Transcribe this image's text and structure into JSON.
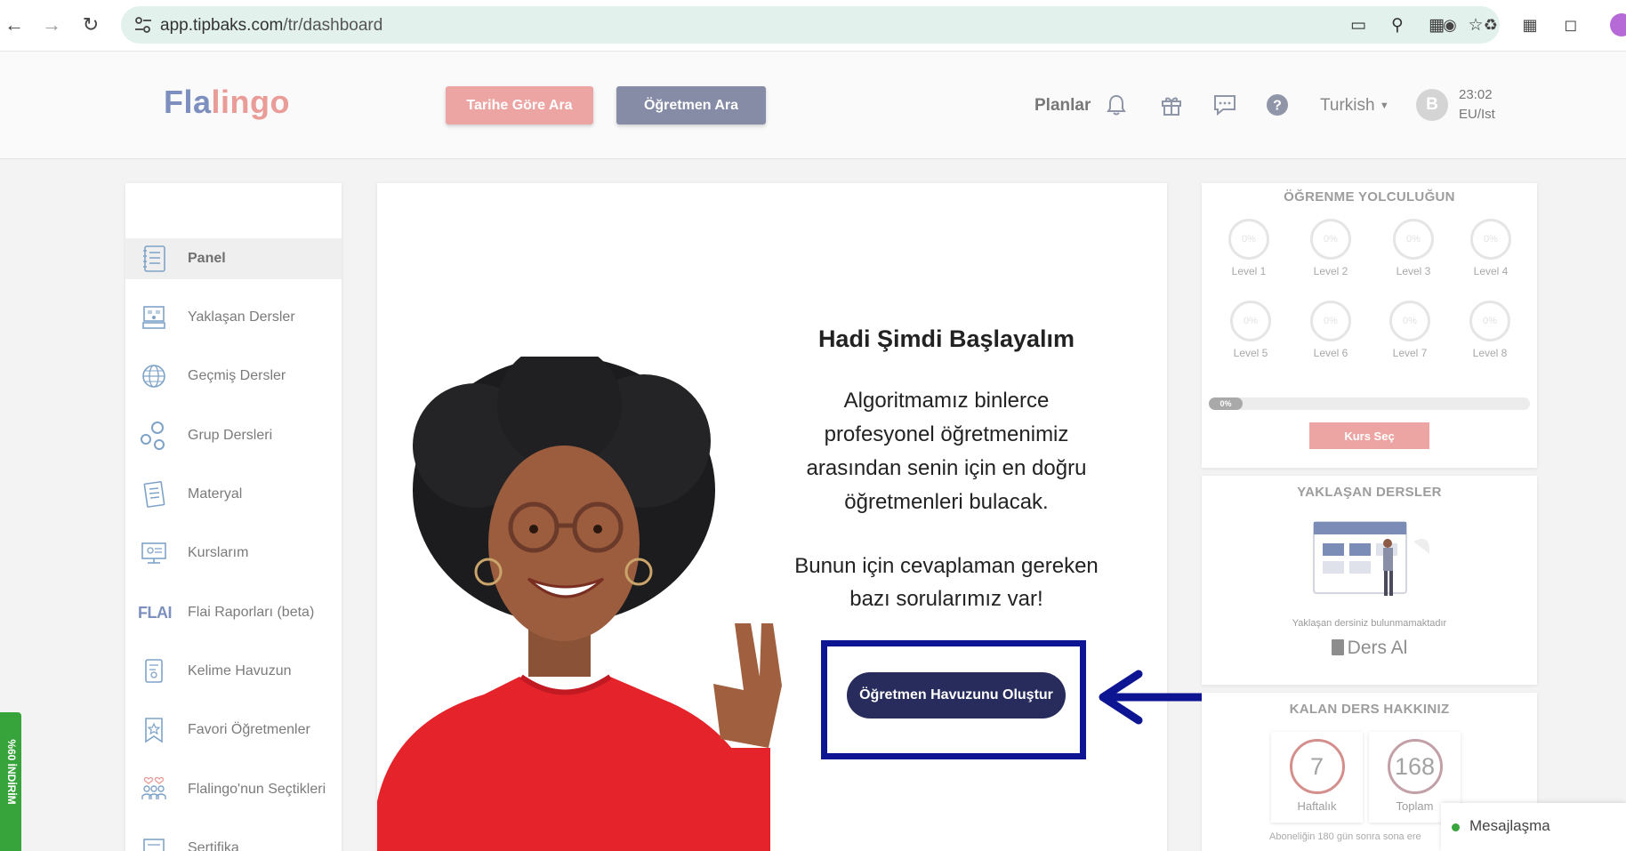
{
  "browser": {
    "url_host": "app.tipbaks.com",
    "url_path": "/tr/dashboard"
  },
  "header": {
    "logo_part1": "Fla",
    "logo_part2": "lingo",
    "btn_date_search": "Tarihe Göre Ara",
    "btn_teacher_search": "Öğretmen Ara",
    "plans": "Planlar",
    "language": "Turkish",
    "avatar_letter": "B",
    "time": "23:02",
    "timezone": "EU/Ist"
  },
  "sidebar": {
    "items": [
      {
        "label": "Panel",
        "icon": "notebook-icon"
      },
      {
        "label": "Yaklaşan Dersler",
        "icon": "calendar-icon"
      },
      {
        "label": "Geçmiş Dersler",
        "icon": "globe-icon"
      },
      {
        "label": "Grup Dersleri",
        "icon": "bubbles-icon"
      },
      {
        "label": "Materyal",
        "icon": "document-icon"
      },
      {
        "label": "Kurslarım",
        "icon": "monitor-icon"
      },
      {
        "label": "Flai Raporları (beta)",
        "icon": "flai-logo"
      },
      {
        "label": "Kelime Havuzun",
        "icon": "book-icon"
      },
      {
        "label": "Favori Öğretmenler",
        "icon": "bookmark-star-icon"
      },
      {
        "label": "Flalingo'nun Seçtikleri",
        "icon": "people-icon"
      },
      {
        "label": "Sertifika",
        "icon": "certificate-icon"
      }
    ],
    "flai_logo_text": "FLAI"
  },
  "main": {
    "title": "Hadi Şimdi Başlayalım",
    "text1": "Algoritmamız binlerce profesyonel öğretmenimiz arasından senin için en doğru öğretmenleri bulacak.",
    "text2": "Bunun için cevaplaman gereken bazı sorularımız var!",
    "create_button": "Öğretmen Havuzunu Oluştur"
  },
  "journey": {
    "title": "ÖĞRENME YOLCULUĞUN",
    "levels": [
      {
        "label": "Level 1",
        "pct": "0%"
      },
      {
        "label": "Level 2",
        "pct": "0%"
      },
      {
        "label": "Level 3",
        "pct": "0%"
      },
      {
        "label": "Level 4",
        "pct": "0%"
      },
      {
        "label": "Level 5",
        "pct": "0%"
      },
      {
        "label": "Level 6",
        "pct": "0%"
      },
      {
        "label": "Level 7",
        "pct": "0%"
      },
      {
        "label": "Level 8",
        "pct": "0%"
      }
    ],
    "progress": "0%",
    "course_button": "Kurs Seç"
  },
  "upcoming": {
    "title": "YAKLAŞAN DERSLER",
    "empty": "Yaklaşan dersiniz bulunmamaktadır",
    "take_lesson": "Ders Al"
  },
  "remaining": {
    "title": "KALAN DERS HAKKINIZ",
    "weekly_value": "7",
    "weekly_label": "Haftalık",
    "total_value": "168",
    "total_label": "Toplam",
    "note": "Aboneliğin 180 gün sonra sona ere"
  },
  "chat": {
    "label": "Mesajlaşma"
  },
  "promo": {
    "label": "%60 İNDİRİM"
  },
  "colors": {
    "brand_blue": "#7c8fbf",
    "brand_pink": "#e99c98",
    "primary_dark": "#272c5c",
    "highlight": "#0d1592"
  }
}
